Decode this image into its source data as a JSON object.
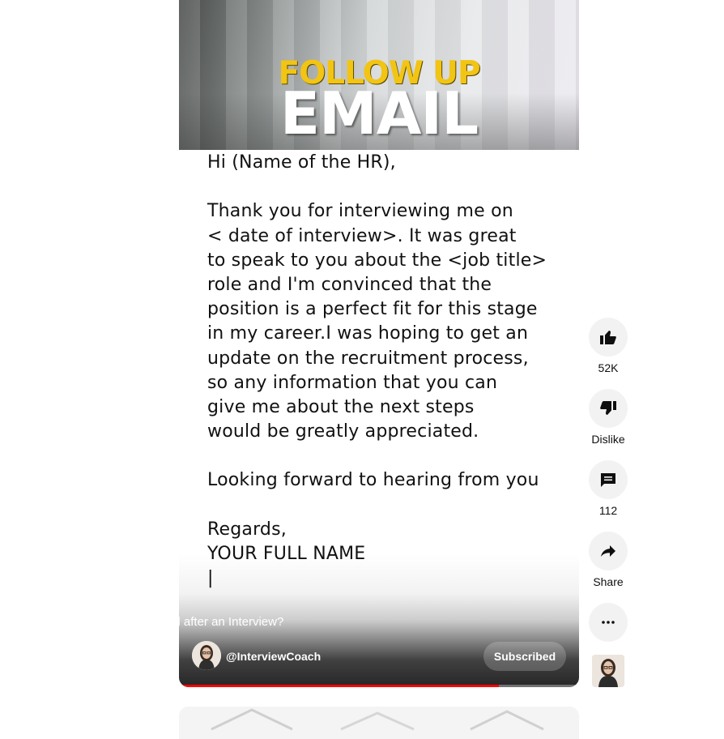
{
  "thumbnail": {
    "title_top": "FOLLOW UP",
    "title_bottom": "EMAIL"
  },
  "letter_lines": [
    "Hi (Name of the HR),",
    "",
    "Thank you for interviewing me on",
    "< date of interview>. It was great",
    "to speak to you about the <job title>",
    "role and I'm convinced that the",
    "position is a perfect fit for this stage",
    "in my career.I was hoping to get an",
    "update on the recruitment process,",
    "so any information that you can",
    "give me about the next steps",
    "would be greatly appreciated.",
    "",
    "Looking forward to hearing from you",
    "",
    "Regards,",
    "YOUR FULL NAME",
    "|"
  ],
  "video": {
    "title": "How to write a Follow-Up email after an Interview?",
    "channel": "@InterviewCoach",
    "subscribe_label": "Subscribed",
    "progress": 0.8
  },
  "actions": {
    "like_count": "52K",
    "dislike_label": "Dislike",
    "comment_count": "112",
    "share_label": "Share"
  },
  "icons": {
    "like": "thumbs-up-icon",
    "dislike": "thumbs-down-icon",
    "comment": "comment-icon",
    "share": "share-icon",
    "more": "more-horizontal-icon"
  }
}
